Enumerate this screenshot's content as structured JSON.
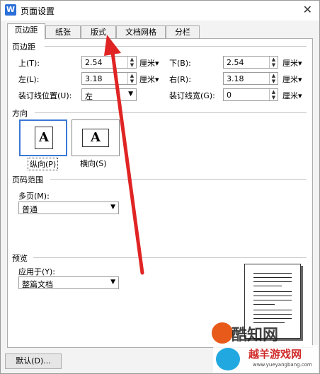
{
  "window": {
    "title": "页面设置",
    "app_icon_letter": "W",
    "close_glyph": "✕"
  },
  "tabs": [
    {
      "label": "页边距"
    },
    {
      "label": "纸张"
    },
    {
      "label": "版式"
    },
    {
      "label": "文档网格"
    },
    {
      "label": "分栏"
    }
  ],
  "margins": {
    "section": "页边距",
    "top": {
      "label": "上(T):",
      "value": "2.54",
      "unit": "厘米▾"
    },
    "bottom": {
      "label": "下(B):",
      "value": "2.54",
      "unit": "厘米▾"
    },
    "left": {
      "label": "左(L):",
      "value": "3.18",
      "unit": "厘米▾"
    },
    "right": {
      "label": "右(R):",
      "value": "3.18",
      "unit": "厘米▾"
    },
    "gutter_pos": {
      "label": "装订线位置(U):",
      "value": "左"
    },
    "gutter_width": {
      "label": "装订线宽(G):",
      "value": "0",
      "unit": "厘米▾"
    }
  },
  "orientation": {
    "section": "方向",
    "portrait": {
      "label": "纵向(P)",
      "glyph": "A"
    },
    "landscape": {
      "label": "横向(S)",
      "glyph": "A"
    }
  },
  "pages": {
    "section": "页码范围",
    "multi_label": "多页(M):",
    "multi_value": "普通"
  },
  "preview": {
    "section": "预览",
    "apply_label": "应用于(Y):",
    "apply_value": "整篇文档"
  },
  "buttons": {
    "default": "默认(D)..."
  },
  "watermarks": {
    "wm1": "酷知网",
    "wm2_title": "越羊游戏网",
    "wm2_url": "www.yueyangbang.com"
  }
}
